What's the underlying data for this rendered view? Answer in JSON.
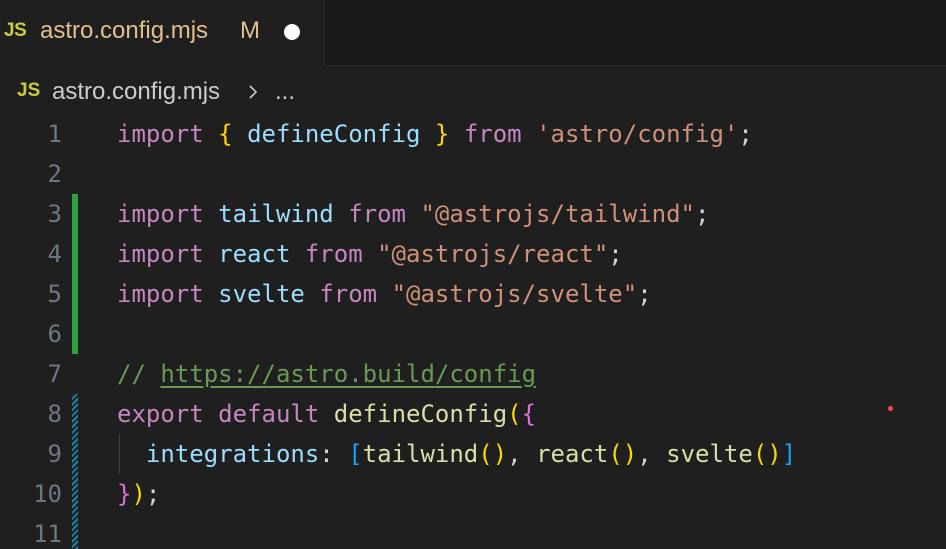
{
  "tab": {
    "icon_label": "JS",
    "icon": "javascript-file-icon",
    "filename": "astro.config.mjs",
    "git_status": "M",
    "dirty_indicator": "unsaved-dot-icon"
  },
  "breadcrumb": {
    "icon_label": "JS",
    "file": "astro.config.mjs",
    "separator_icon": "chevron-right-icon",
    "more": "..."
  },
  "editor": {
    "line_numbers": [
      "1",
      "2",
      "3",
      "4",
      "5",
      "6",
      "7",
      "8",
      "9",
      "10",
      "11"
    ],
    "lines": {
      "l1": {
        "t1": "import",
        "t2": "{",
        "t3": "defineConfig",
        "t4": "}",
        "t5": "from",
        "t6": "'astro/config'",
        "t7": ";"
      },
      "l3": {
        "t1": "import",
        "t2": "tailwind",
        "t3": "from",
        "t4": "\"@astrojs/tailwind\"",
        "t5": ";"
      },
      "l4": {
        "t1": "import",
        "t2": "react",
        "t3": "from",
        "t4": "\"@astrojs/react\"",
        "t5": ";"
      },
      "l5": {
        "t1": "import",
        "t2": "svelte",
        "t3": "from",
        "t4": "\"@astrojs/svelte\"",
        "t5": ";"
      },
      "l7": {
        "t1": "//",
        "t2": "https://astro.build/config"
      },
      "l8": {
        "t1": "export",
        "t2": "default",
        "t3": "defineConfig",
        "t4": "(",
        "t5": "{"
      },
      "l9": {
        "t1": "integrations",
        "t2": ":",
        "t3": "[",
        "t4": "tailwind",
        "t5": "()",
        "t6": ",",
        "t7": "react",
        "t8": "()",
        "t9": ",",
        "t10": "svelte",
        "t11": "()",
        "t12": "]"
      },
      "l10": {
        "t1": "}",
        "t2": ")",
        "t3": ";"
      }
    },
    "gutter": {
      "added_lines": [
        "3",
        "4",
        "5",
        "6"
      ],
      "modified_lines": [
        "8",
        "9",
        "10",
        "11"
      ]
    }
  },
  "colors": {
    "background": "#1f1f1f",
    "tab_modified_text": "#e2c08d",
    "js_icon": "#cbcb41",
    "keyword": "#c586c0",
    "variable": "#9cdcfe",
    "function": "#dcdcaa",
    "string": "#ce9178",
    "comment": "#6a9955",
    "git_added": "#2ea043",
    "git_modified": "#1b81a8"
  }
}
